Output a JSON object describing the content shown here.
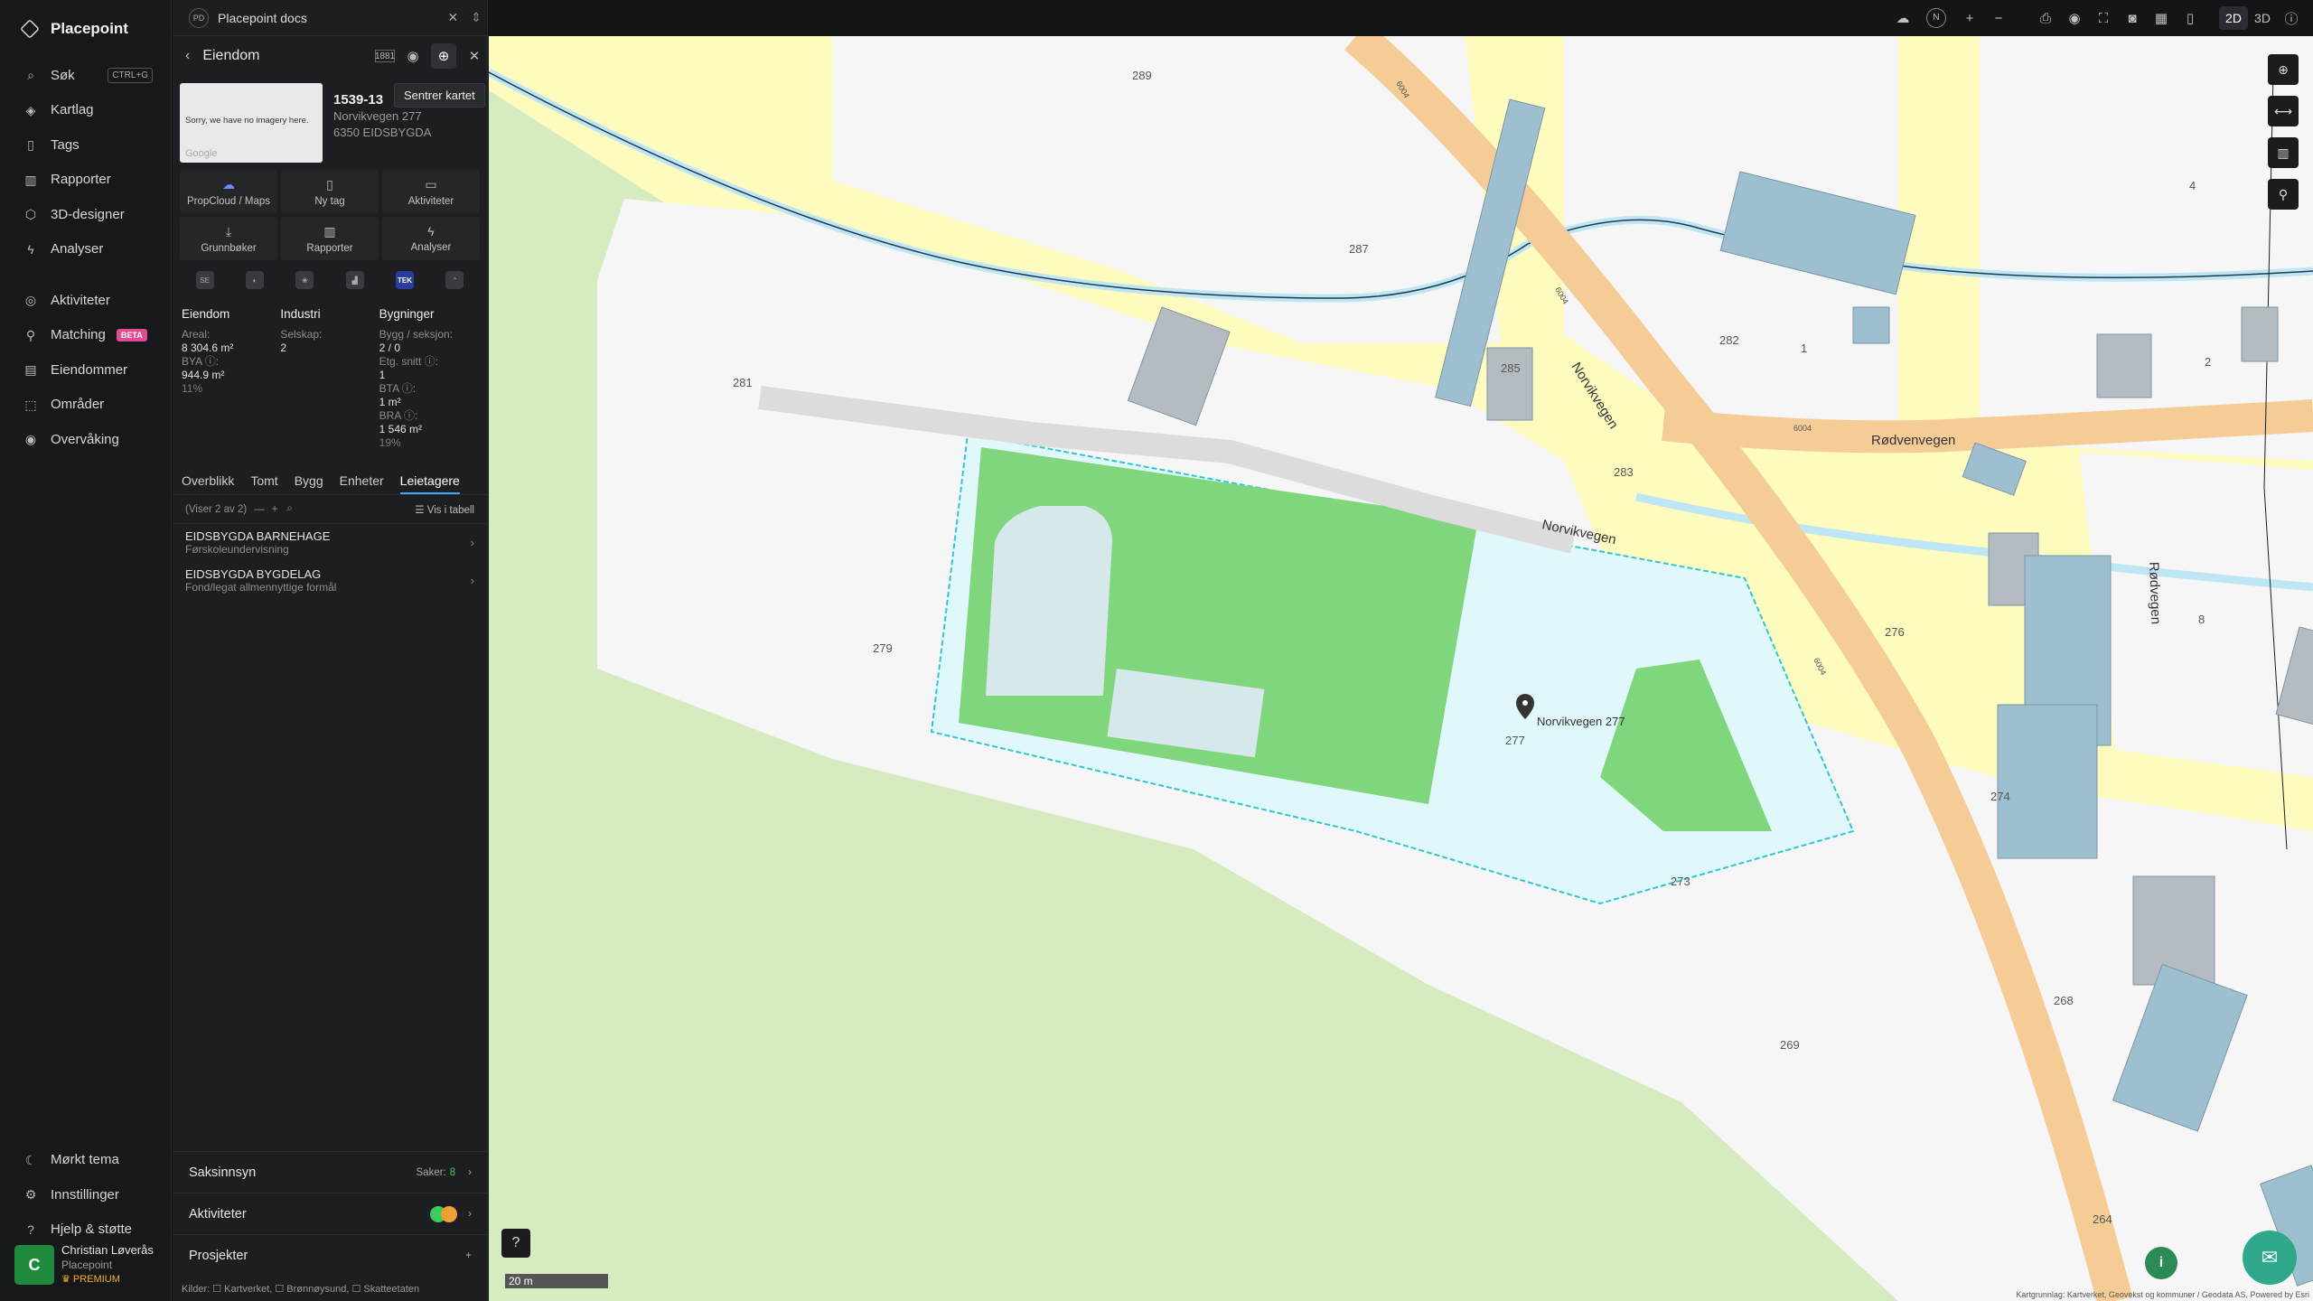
{
  "brand": {
    "name": "Placepoint"
  },
  "nav": {
    "items": [
      {
        "label": "Søk",
        "kbd": "CTRL+G"
      },
      {
        "label": "Kartlag"
      },
      {
        "label": "Tags"
      },
      {
        "label": "Rapporter"
      },
      {
        "label": "3D-designer"
      },
      {
        "label": "Analyser"
      },
      {
        "label": "Aktiviteter"
      },
      {
        "label": "Matching",
        "badge": "BETA"
      },
      {
        "label": "Eiendommer"
      },
      {
        "label": "Områder"
      },
      {
        "label": "Overvåking"
      }
    ],
    "bottom": [
      {
        "label": "Mørkt tema"
      },
      {
        "label": "Innstillinger"
      },
      {
        "label": "Hjelp & støtte"
      }
    ]
  },
  "user": {
    "initial": "C",
    "name": "Christian Løverås",
    "org": "Placepoint",
    "plan": "PREMIUM"
  },
  "docs": {
    "badge": "PD",
    "title": "Placepoint docs"
  },
  "panel": {
    "title": "Eiendom",
    "tooltip": "Sentrer kartet",
    "thumb_text": "Sorry, we have no imagery here.",
    "thumb_credit": "Google",
    "property_id": "1539-13",
    "address": "Norvikvegen 277",
    "postal": "6350 EIDSBYGDA",
    "actions": [
      "PropCloud / Maps",
      "Ny tag",
      "Aktiviteter",
      "Grunnbøker",
      "Rapporter",
      "Analyser"
    ],
    "source_tek": "TEK",
    "stats": {
      "eiendom": {
        "h": "Eiendom",
        "areal_l": "Areal:",
        "areal_v": "8 304.6 m²",
        "bya_l": "BYA ⓘ:",
        "bya_v": "944.9 m²",
        "bya_p": "11%"
      },
      "industri": {
        "h": "Industri",
        "sel_l": "Selskap:",
        "sel_v": "2"
      },
      "bygninger": {
        "h": "Bygninger",
        "bs_l": "Bygg / seksjon:",
        "bs_v": "2 / 0",
        "es_l": "Etg. snitt ⓘ:",
        "es_v": "1",
        "bta_l": "BTA ⓘ:",
        "bta_v": "1 m²",
        "bra_l": "BRA ⓘ:",
        "bra_v": "1 546 m²",
        "bra_p": "19%"
      }
    },
    "tabs": [
      "Overblikk",
      "Tomt",
      "Bygg",
      "Enheter",
      "Leietagere"
    ],
    "list_count": "(Viser 2 av 2)",
    "list_view": "Vis i tabell",
    "tenants": [
      {
        "name": "EIDSBYGDA BARNEHAGE",
        "type": "Førskoleundervisning"
      },
      {
        "name": "EIDSBYGDA BYGDELAG",
        "type": "Fond/legat allmennyttige formål"
      }
    ],
    "saksinnsyn": "Saksinnsyn",
    "saker_l": "Saker:",
    "saker_v": "8",
    "aktiviteter": "Aktiviteter",
    "prosjekter": "Prosjekter",
    "kilder": "Kilder: ☐ Kartverket, ☐ Brønnøysund, ☐ Skatteetaten"
  },
  "topbar": {
    "mode_2d": "2D",
    "mode_3d": "3D",
    "north": "N"
  },
  "map": {
    "scale": "20 m",
    "attribution": "Kartgrunnlag: Kartverket, Geovekst og kommuner / Geodata AS, Powered by Esri",
    "marker_label": "Norvikvegen 277",
    "roads": [
      "Norvikvegen",
      "Norvikvegen",
      "Rødvenvegen",
      "Rødvegen"
    ],
    "road_codes": [
      "6004",
      "6004",
      "6004",
      "6004",
      "6004"
    ],
    "house_numbers": [
      "289",
      "287",
      "281",
      "285",
      "282",
      "1",
      "283",
      "279",
      "277",
      "276",
      "274",
      "273",
      "268",
      "269",
      "264",
      "8",
      "4",
      "2"
    ],
    "colors": {
      "residential": "#fdfbbe",
      "forest": "#d6ecc0",
      "plot": "#f6f6f6",
      "building": "#9ebfd0",
      "selected": "#e1f8fb",
      "green": "#7fd67c",
      "road": "#f5cc96",
      "river": "#bfe6f4"
    }
  }
}
